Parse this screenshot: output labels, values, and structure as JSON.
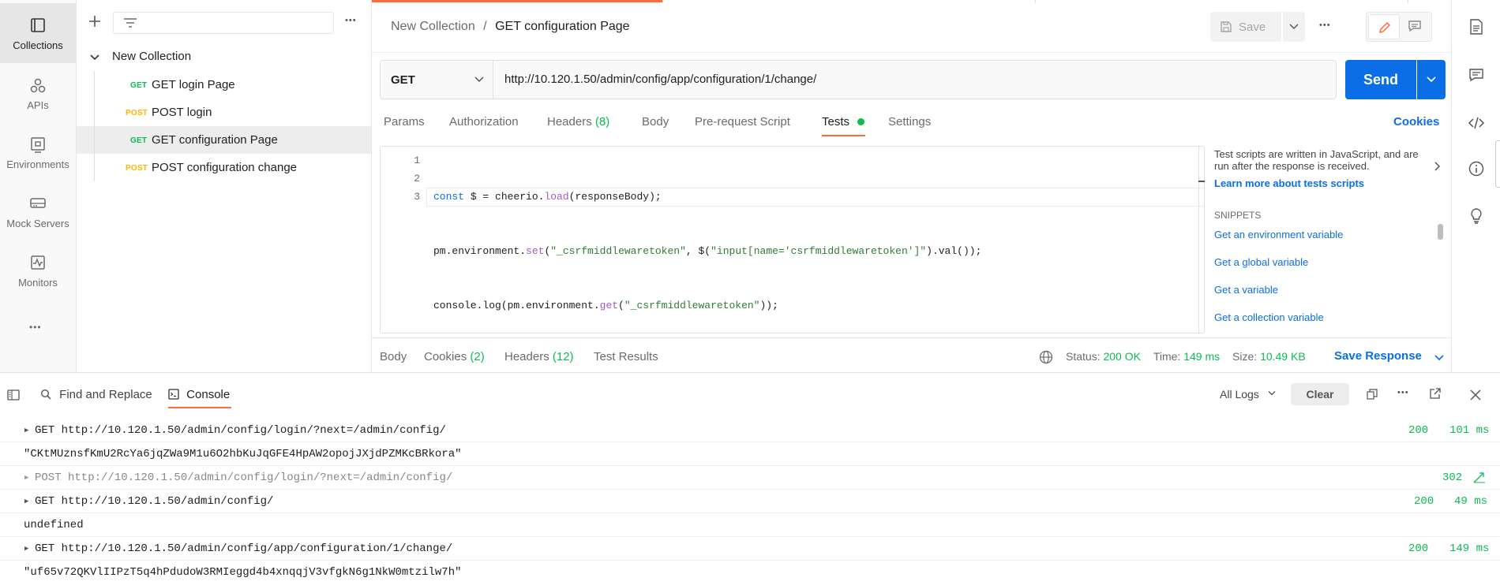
{
  "rail": {
    "items": [
      {
        "label": "Collections",
        "icon": "collections-icon",
        "active": true
      },
      {
        "label": "APIs",
        "icon": "apis-icon"
      },
      {
        "label": "Environments",
        "icon": "environments-icon"
      },
      {
        "label": "Mock Servers",
        "icon": "mock-servers-icon"
      },
      {
        "label": "Monitors",
        "icon": "monitors-icon"
      }
    ],
    "more": "•••"
  },
  "sidebar": {
    "more": "•••",
    "collection": "New Collection",
    "requests": [
      {
        "method": "GET",
        "name": "GET login Page"
      },
      {
        "method": "POST",
        "name": "POST login"
      },
      {
        "method": "GET",
        "name": "GET configuration Page",
        "selected": true
      },
      {
        "method": "POST",
        "name": "POST configuration change"
      }
    ]
  },
  "header": {
    "breadcrumb_parent": "New Collection",
    "separator": "/",
    "title": "GET configuration Page",
    "save_label": "Save",
    "more": "•••"
  },
  "request": {
    "method": "GET",
    "url": "http://10.120.1.50/admin/config/app/configuration/1/change/",
    "send_label": "Send"
  },
  "tabs": {
    "params": "Params",
    "authorization": "Authorization",
    "headers": "Headers",
    "headers_count": "(8)",
    "body": "Body",
    "prerequest": "Pre-request Script",
    "tests": "Tests",
    "settings": "Settings",
    "cookies": "Cookies"
  },
  "editor": {
    "lines": [
      {
        "n": "1"
      },
      {
        "n": "2"
      },
      {
        "n": "3"
      }
    ]
  },
  "snippets": {
    "intro": "Test scripts are written in JavaScript, and are run after the response is received.",
    "learn_more": "Learn more about tests scripts",
    "heading": "SNIPPETS",
    "items": [
      "Get an environment variable",
      "Get a global variable",
      "Get a variable",
      "Get a collection variable"
    ]
  },
  "response": {
    "body": "Body",
    "cookies": "Cookies",
    "cookies_count": "(2)",
    "headers": "Headers",
    "headers_count": "(12)",
    "test_results": "Test Results",
    "status_label": "Status:",
    "status_value": "200 OK",
    "time_label": "Time:",
    "time_value": "149 ms",
    "size_label": "Size:",
    "size_value": "10.49 KB",
    "save_response": "Save Response"
  },
  "console": {
    "find_replace": "Find and Replace",
    "console_tab": "Console",
    "all_logs": "All Logs",
    "clear": "Clear",
    "more": "•••",
    "rows": [
      {
        "type": "request",
        "text": "GET http://10.120.1.50/admin/config/login/?next=/admin/config/",
        "status": "200",
        "time": "101 ms"
      },
      {
        "type": "log",
        "text": "\"CKtMUznsfKmU2RcYa6jqZWa9M1u6O2hbKuJqGFE4HpAW2opojJXjdPZMKcBRkora\""
      },
      {
        "type": "redirect",
        "text": "POST http://10.120.1.50/admin/config/login/?next=/admin/config/",
        "status": "302"
      },
      {
        "type": "request",
        "text": "GET http://10.120.1.50/admin/config/",
        "status": "200",
        "time": "49 ms"
      },
      {
        "type": "log",
        "text": "undefined"
      },
      {
        "type": "request",
        "text": "GET http://10.120.1.50/admin/config/app/configuration/1/change/",
        "status": "200",
        "time": "149 ms"
      },
      {
        "type": "log",
        "text": "\"uf65v72QKVlIIPzT5q4hPdudoW3RMIeggd4b4xnqqjV3vfgkN6g1NkW0mtzilw7h\""
      }
    ]
  },
  "colors": {
    "accent": "#0b6ee7",
    "orange": "#ff6c37",
    "green": "#0cbb52",
    "get": "#0cbb52",
    "post": "#ffb400"
  }
}
